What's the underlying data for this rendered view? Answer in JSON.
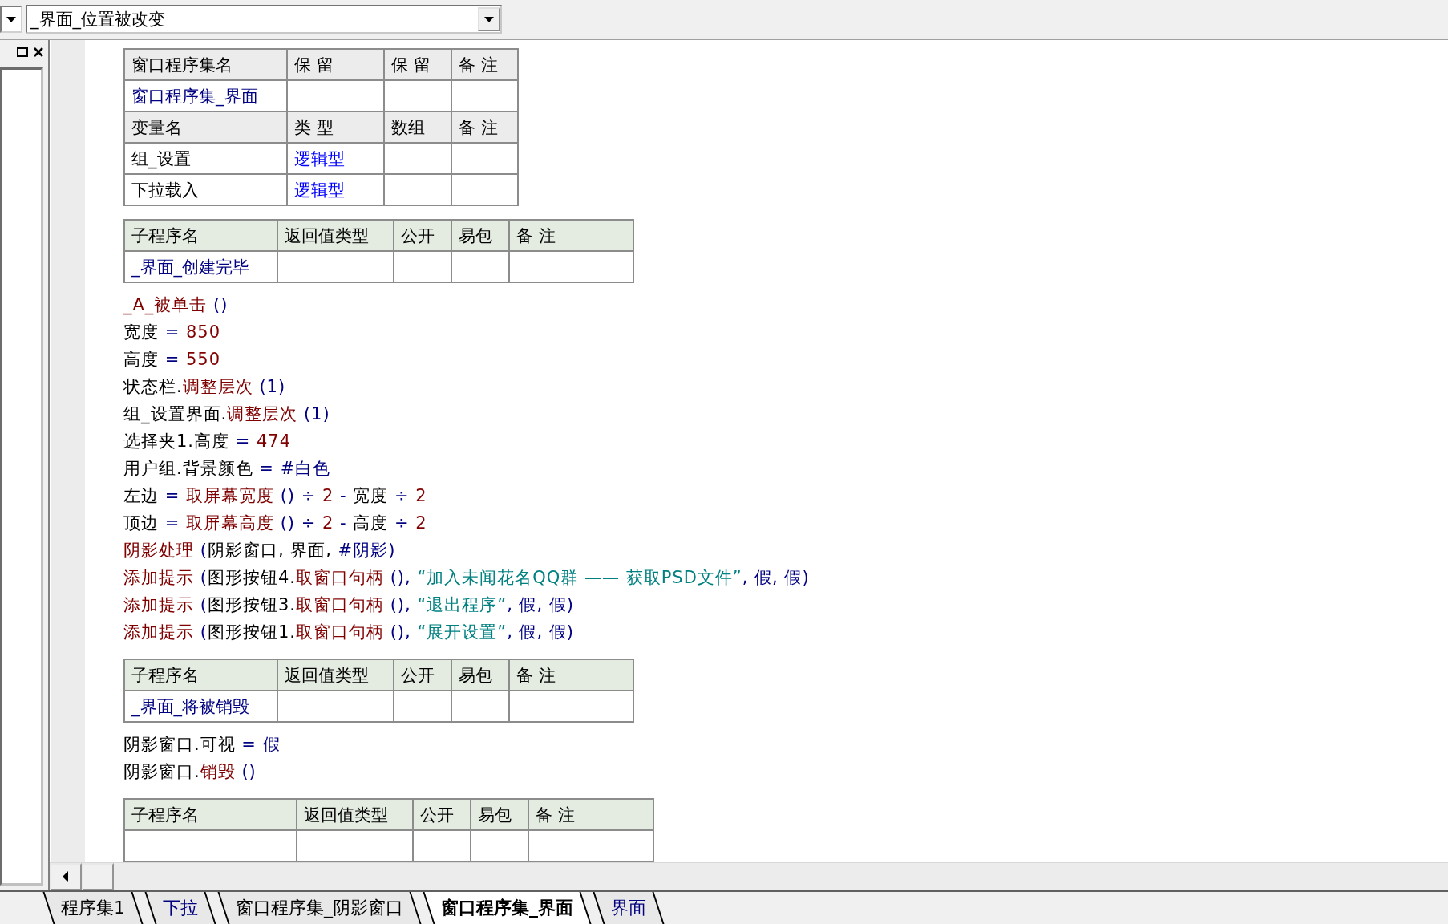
{
  "toolbar": {
    "event_select": {
      "value": "_界面_位置被改变"
    }
  },
  "editor": {
    "blocks": [
      {
        "kind": "assembly_table",
        "rows": [
          {
            "kind": "header",
            "cells": [
              {
                "text": "窗口程序集名",
                "kind": "plain"
              },
              {
                "text": "保 留",
                "kind": "plain"
              },
              {
                "text": "保 留",
                "kind": "plain"
              },
              {
                "text": "备 注",
                "kind": "plain"
              }
            ]
          },
          {
            "kind": "row",
            "cells": [
              {
                "text": "窗口程序集_界面",
                "kind": "name"
              }
            ]
          },
          {
            "kind": "header",
            "cells": [
              {
                "text": "变量名",
                "kind": "plain"
              },
              {
                "text": "类 型",
                "kind": "plain"
              },
              {
                "text": "数组",
                "kind": "plain"
              },
              {
                "text": "备 注",
                "kind": "plain"
              }
            ]
          },
          {
            "kind": "row",
            "cells": [
              {
                "text": "组_设置",
                "kind": "plain"
              },
              {
                "text": "逻辑型",
                "kind": "type"
              }
            ]
          },
          {
            "kind": "row",
            "cells": [
              {
                "text": "下拉载入",
                "kind": "plain"
              },
              {
                "text": "逻辑型",
                "kind": "type"
              }
            ]
          }
        ]
      },
      {
        "kind": "sub_table",
        "rows": [
          {
            "kind": "header",
            "cells": [
              {
                "text": "子程序名",
                "kind": "plain"
              },
              {
                "text": "返回值类型",
                "kind": "plain"
              },
              {
                "text": "公开",
                "kind": "plain"
              },
              {
                "text": "易包",
                "kind": "plain"
              },
              {
                "text": "备 注",
                "kind": "plain"
              }
            ]
          },
          {
            "kind": "row",
            "cells": [
              {
                "text": "_界面_创建完毕",
                "kind": "name"
              }
            ]
          }
        ]
      },
      {
        "kind": "code",
        "lines": [
          [
            {
              "text": "_A_被单击 ",
              "kind": "call"
            },
            {
              "text": "()",
              "kind": "symbol"
            }
          ],
          [
            {
              "text": "宽度 ",
              "kind": "plain"
            },
            {
              "text": "= ",
              "kind": "symbol"
            },
            {
              "text": "850",
              "kind": "number"
            }
          ],
          [
            {
              "text": "高度 ",
              "kind": "plain"
            },
            {
              "text": "= ",
              "kind": "symbol"
            },
            {
              "text": "550",
              "kind": "number"
            }
          ],
          [
            {
              "text": "状态栏.",
              "kind": "plain"
            },
            {
              "text": "调整层次 ",
              "kind": "call"
            },
            {
              "text": "(1)",
              "kind": "symbol"
            }
          ],
          [
            {
              "text": "组_设置界面.",
              "kind": "plain"
            },
            {
              "text": "调整层次 ",
              "kind": "call"
            },
            {
              "text": "(1)",
              "kind": "symbol"
            }
          ],
          [
            {
              "text": "选择夹1.高度 ",
              "kind": "plain"
            },
            {
              "text": "= ",
              "kind": "symbol"
            },
            {
              "text": "474",
              "kind": "number"
            }
          ],
          [
            {
              "text": "用户组.背景颜色 ",
              "kind": "plain"
            },
            {
              "text": "= #白色",
              "kind": "symbol"
            }
          ],
          [
            {
              "text": "左边 ",
              "kind": "plain"
            },
            {
              "text": "= ",
              "kind": "symbol"
            },
            {
              "text": "取屏幕宽度 ",
              "kind": "call"
            },
            {
              "text": "() ÷ ",
              "kind": "symbol"
            },
            {
              "text": "2",
              "kind": "number"
            },
            {
              "text": " - ",
              "kind": "symbol"
            },
            {
              "text": "宽度 ",
              "kind": "plain"
            },
            {
              "text": "÷ ",
              "kind": "symbol"
            },
            {
              "text": "2",
              "kind": "number"
            }
          ],
          [
            {
              "text": "顶边 ",
              "kind": "plain"
            },
            {
              "text": "= ",
              "kind": "symbol"
            },
            {
              "text": "取屏幕高度 ",
              "kind": "call"
            },
            {
              "text": "() ÷ ",
              "kind": "symbol"
            },
            {
              "text": "2",
              "kind": "number"
            },
            {
              "text": " - ",
              "kind": "symbol"
            },
            {
              "text": "高度 ",
              "kind": "plain"
            },
            {
              "text": "÷ ",
              "kind": "symbol"
            },
            {
              "text": "2",
              "kind": "number"
            }
          ],
          [
            {
              "text": "阴影处理 ",
              "kind": "call"
            },
            {
              "text": "(",
              "kind": "symbol"
            },
            {
              "text": "阴影窗口, 界面, ",
              "kind": "plain"
            },
            {
              "text": "#阴影)",
              "kind": "symbol"
            }
          ],
          [
            {
              "text": "添加提示 ",
              "kind": "call"
            },
            {
              "text": "(",
              "kind": "symbol"
            },
            {
              "text": "图形按钮4.",
              "kind": "plain"
            },
            {
              "text": "取窗口句柄 ",
              "kind": "call"
            },
            {
              "text": "(), ",
              "kind": "symbol"
            },
            {
              "text": "“加入未闻花名QQ群 —— 获取PSD文件”",
              "kind": "string"
            },
            {
              "text": ", 假, 假)",
              "kind": "symbol"
            }
          ],
          [
            {
              "text": "添加提示 ",
              "kind": "call"
            },
            {
              "text": "(",
              "kind": "symbol"
            },
            {
              "text": "图形按钮3.",
              "kind": "plain"
            },
            {
              "text": "取窗口句柄 ",
              "kind": "call"
            },
            {
              "text": "(), ",
              "kind": "symbol"
            },
            {
              "text": "“退出程序”",
              "kind": "string"
            },
            {
              "text": ", 假, 假)",
              "kind": "symbol"
            }
          ],
          [
            {
              "text": "添加提示 ",
              "kind": "call"
            },
            {
              "text": "(",
              "kind": "symbol"
            },
            {
              "text": "图形按钮1.",
              "kind": "plain"
            },
            {
              "text": "取窗口句柄 ",
              "kind": "call"
            },
            {
              "text": "(), ",
              "kind": "symbol"
            },
            {
              "text": "“展开设置”",
              "kind": "string"
            },
            {
              "text": ", 假, 假)",
              "kind": "symbol"
            }
          ]
        ]
      },
      {
        "kind": "sub_table",
        "rows": [
          {
            "kind": "header",
            "cells": [
              {
                "text": "子程序名",
                "kind": "plain"
              },
              {
                "text": "返回值类型",
                "kind": "plain"
              },
              {
                "text": "公开",
                "kind": "plain"
              },
              {
                "text": "易包",
                "kind": "plain"
              },
              {
                "text": "备 注",
                "kind": "plain"
              }
            ]
          },
          {
            "kind": "row",
            "cells": [
              {
                "text": "_界面_将被销毁",
                "kind": "name"
              }
            ]
          }
        ]
      },
      {
        "kind": "code",
        "lines": [
          [
            {
              "text": "阴影窗口.可视 ",
              "kind": "plain"
            },
            {
              "text": "= 假",
              "kind": "symbol"
            }
          ],
          [
            {
              "text": "阴影窗口.",
              "kind": "plain"
            },
            {
              "text": "销毁 ",
              "kind": "call"
            },
            {
              "text": "()",
              "kind": "symbol"
            }
          ]
        ]
      },
      {
        "kind": "sub_table_wide",
        "rows": [
          {
            "kind": "header",
            "cells": [
              {
                "text": "子程序名",
                "kind": "plain"
              },
              {
                "text": "返回值类型",
                "kind": "plain"
              },
              {
                "text": "公开",
                "kind": "plain"
              },
              {
                "text": "易包",
                "kind": "plain"
              },
              {
                "text": "备 注",
                "kind": "plain"
              }
            ]
          },
          {
            "kind": "row",
            "cells": []
          }
        ]
      }
    ]
  },
  "tabs": [
    {
      "label": "程序集1",
      "kind": "assembly",
      "selected": false
    },
    {
      "label": "下拉",
      "kind": "form",
      "selected": false
    },
    {
      "label": "窗口程序集_阴影窗口",
      "kind": "assembly",
      "selected": false
    },
    {
      "label": "窗口程序集_界面",
      "kind": "assembly",
      "selected": true
    },
    {
      "label": "界面",
      "kind": "form",
      "selected": false
    }
  ]
}
